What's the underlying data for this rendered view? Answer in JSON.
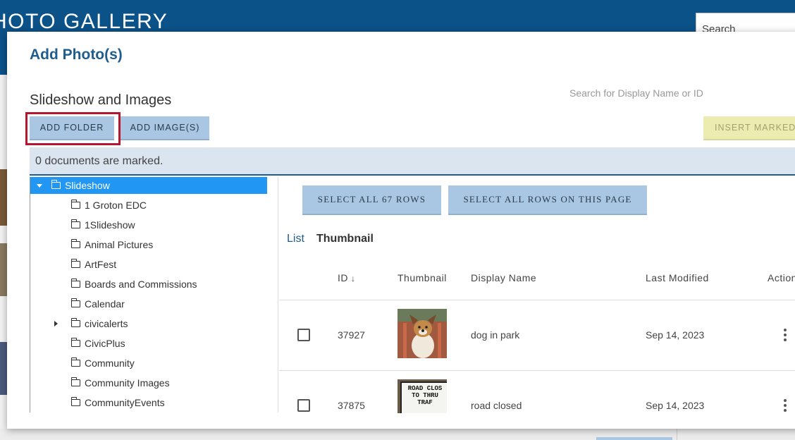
{
  "background": {
    "site_title": "HOTO GALLERY",
    "search_placeholder": "Search"
  },
  "modal": {
    "title": "Add Photo(s)",
    "section_title": "Slideshow and Images",
    "search_placeholder": "Search for Display Name or ID",
    "buttons": {
      "add_folder": "ADD FOLDER",
      "add_images": "ADD IMAGE(S)",
      "insert_marked": "INSERT MARKED"
    },
    "marked_status": "0 documents are marked."
  },
  "tree": {
    "root": "Slideshow",
    "items": [
      {
        "label": "1 Groton EDC",
        "expandable": false
      },
      {
        "label": "1Slideshow",
        "expandable": false
      },
      {
        "label": "Animal Pictures",
        "expandable": false
      },
      {
        "label": "ArtFest",
        "expandable": false
      },
      {
        "label": "Boards and Commissions",
        "expandable": false
      },
      {
        "label": "Calendar",
        "expandable": false
      },
      {
        "label": "civicalerts",
        "expandable": true
      },
      {
        "label": "CivicPlus",
        "expandable": false
      },
      {
        "label": "Community",
        "expandable": false
      },
      {
        "label": "Community Images",
        "expandable": false
      },
      {
        "label": "CommunityEvents",
        "expandable": false
      }
    ]
  },
  "grid": {
    "select_all_rows": "SELECT ALL 67 ROWS",
    "select_page_rows": "SELECT ALL ROWS ON THIS PAGE",
    "views": {
      "list": "List",
      "thumbnail": "Thumbnail"
    },
    "columns": {
      "id": "ID",
      "thumbnail": "Thumbnail",
      "display_name": "Display Name",
      "last_modified": "Last Modified",
      "actions": "Actions"
    },
    "rows": [
      {
        "id": "37927",
        "display_name": "dog in park",
        "last_modified": "Sep 14, 2023",
        "thumb_text": ""
      },
      {
        "id": "37875",
        "display_name": "road closed",
        "last_modified": "Sep 14, 2023",
        "thumb_text": "ROAD CLOS TO THRU TRAF"
      }
    ]
  },
  "colors": {
    "header_blue": "#0b5289",
    "button_blue": "#a9c7e2",
    "selected_tree": "#2196f3",
    "highlight_red": "#b5172e",
    "insert_disabled": "#ecebb0"
  }
}
